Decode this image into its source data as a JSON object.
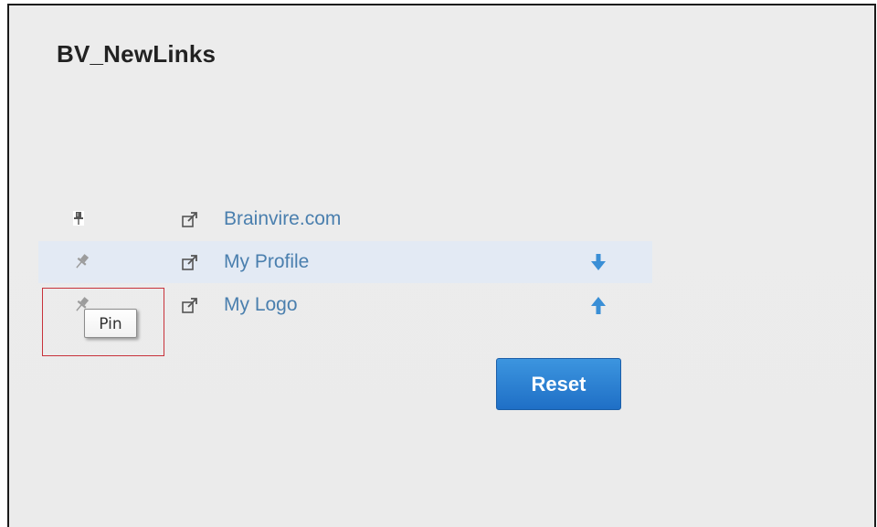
{
  "widget": {
    "title": "BV_NewLinks"
  },
  "links": [
    {
      "label": "Brainvire.com",
      "pinned": true,
      "arrow": null
    },
    {
      "label": "My Profile",
      "pinned": false,
      "arrow": "down"
    },
    {
      "label": "My Logo",
      "pinned": false,
      "arrow": "up"
    }
  ],
  "tooltip": {
    "text": "Pin"
  },
  "reset_button": {
    "label": "Reset"
  },
  "colors": {
    "link": "#4a7fae",
    "highlight_row": "#e3eaf4",
    "arrow": "#3a8fd6",
    "button": "#2a7fd4",
    "tooltip_outline": "#c8323a"
  },
  "icons": {
    "pin": "pin-icon",
    "external_link": "external-link-icon",
    "arrow_down": "arrow-down-icon",
    "arrow_up": "arrow-up-icon"
  }
}
